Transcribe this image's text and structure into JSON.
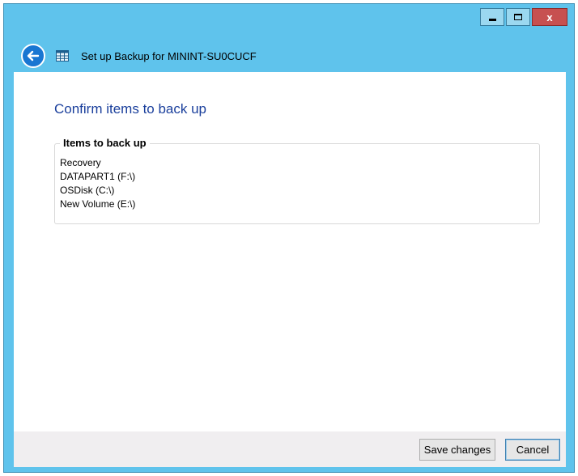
{
  "window": {
    "title": "Set up Backup for MININT-SU0CUCF",
    "controls": {
      "minimize_icon": "minimize-icon",
      "maximize_icon": "maximize-icon",
      "close_label": "x"
    },
    "back_icon": "back-arrow-icon",
    "app_icon": "backup-app-icon"
  },
  "main": {
    "heading": "Confirm items to back up",
    "group": {
      "label": "Items to back up",
      "items": [
        "Recovery",
        "DATAPART1 (F:\\)",
        "OSDisk (C:\\)",
        "New Volume (E:\\)"
      ]
    }
  },
  "footer": {
    "save_label": "Save changes",
    "cancel_label": "Cancel"
  },
  "colors": {
    "titlebar": "#5fc3ec",
    "heading": "#1a3f9c",
    "close_button": "#c75050",
    "back_button": "#1976d2"
  }
}
